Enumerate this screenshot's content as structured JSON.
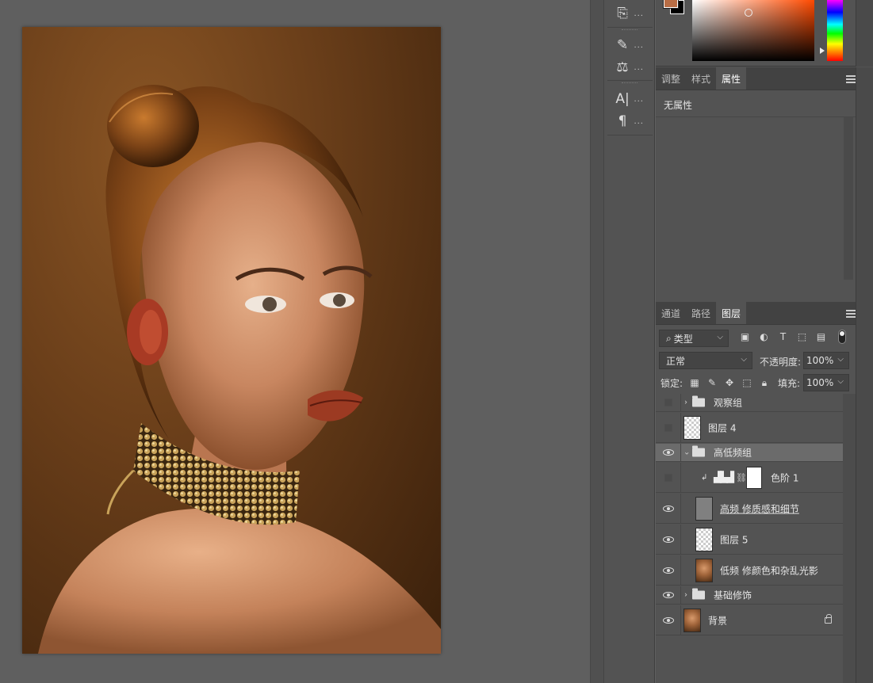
{
  "tools": {
    "items": [
      {
        "name": "history-brush-tool",
        "glyph": "⎘",
        "dots": "..."
      },
      {
        "name": "brushes-tool",
        "glyph": "✎",
        "dots": "..."
      },
      {
        "name": "adjust-tool",
        "glyph": "⚖",
        "dots": "..."
      },
      {
        "name": "character-tool",
        "glyph": "A|",
        "dots": "..."
      },
      {
        "name": "paragraph-tool",
        "glyph": "¶",
        "dots": "..."
      }
    ]
  },
  "colors": {
    "foreground": "#b86d45",
    "background": "#000000"
  },
  "properties_panel": {
    "tabs": [
      "调整",
      "样式",
      "属性"
    ],
    "active_tab": "属性",
    "empty_label": "无属性"
  },
  "layers_panel": {
    "tabs": [
      "通道",
      "路径",
      "图层"
    ],
    "active_tab": "图层",
    "filter_label": "类型",
    "blend_mode": "正常",
    "opacity_label": "不透明度:",
    "opacity_value": "100%",
    "lock_label": "锁定:",
    "fill_label": "填充:",
    "fill_value": "100%",
    "layers": [
      {
        "name": "观察组",
        "kind": "group",
        "visible": false,
        "expanded": false
      },
      {
        "name": "图层 4",
        "kind": "layer",
        "visible": false
      },
      {
        "name": "高低频组",
        "kind": "group",
        "visible": true,
        "expanded": true,
        "selected": true
      },
      {
        "name": "色阶 1",
        "kind": "adjustment",
        "visible": false
      },
      {
        "name": "高频 修质感和细节",
        "kind": "layer",
        "visible": true
      },
      {
        "name": "图层 5",
        "kind": "layer",
        "visible": true
      },
      {
        "name": "低频 修颜色和杂乱光影",
        "kind": "layer",
        "visible": true
      },
      {
        "name": "基础修饰",
        "kind": "group",
        "visible": true,
        "expanded": false
      },
      {
        "name": "背景",
        "kind": "background",
        "visible": true,
        "locked": true
      }
    ]
  }
}
